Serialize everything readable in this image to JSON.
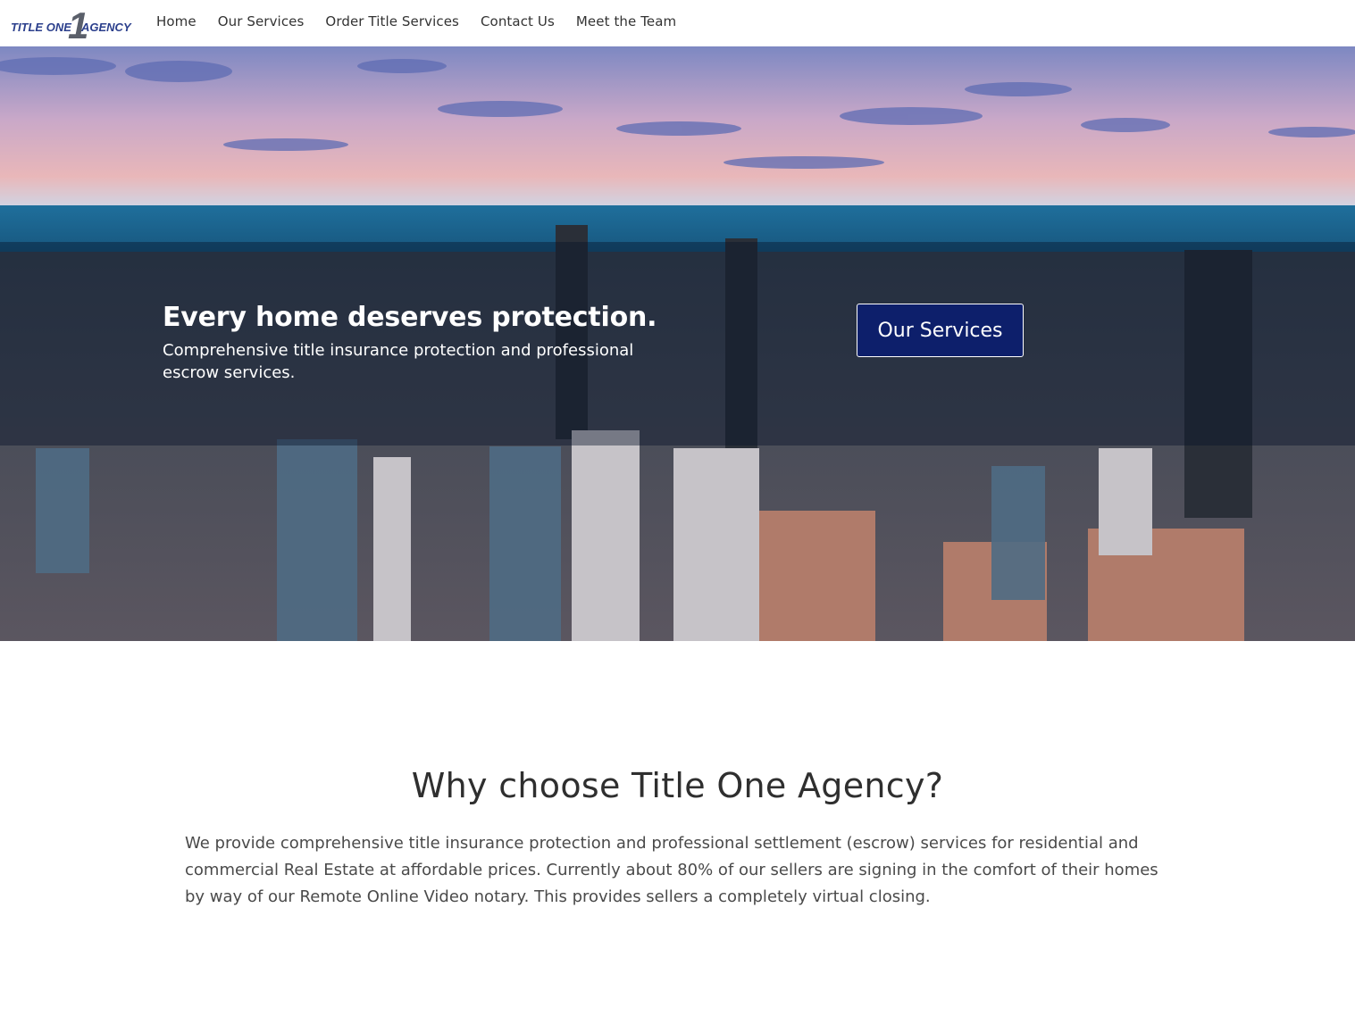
{
  "brand": {
    "logo_text_left": "TITLE ONE",
    "logo_numeral": "1",
    "logo_text_right": "AGENCY"
  },
  "nav": {
    "items": [
      {
        "label": "Home"
      },
      {
        "label": "Our Services"
      },
      {
        "label": "Order Title Services"
      },
      {
        "label": "Contact Us"
      },
      {
        "label": "Meet the Team"
      }
    ]
  },
  "hero": {
    "heading": "Every home deserves protection.",
    "subheading": "Comprehensive title insurance protection and professional escrow services.",
    "cta_label": "Our Services",
    "background": "aerial-city-skyline-at-dusk"
  },
  "why": {
    "title": "Why choose Title One Agency?",
    "body": "We provide comprehensive title insurance protection and professional settlement (escrow) services for residential and commercial Real Estate at affordable prices. Currently about 80% of our sellers are signing in the comfort of their homes by way of our Remote Online Video notary. This provides sellers a completely virtual closing."
  },
  "colors": {
    "brand_navy": "#0d1f6b",
    "logo_blue": "#2b3f8c",
    "text_dark": "#2f2f2f",
    "text_body": "#4a4a4a"
  }
}
